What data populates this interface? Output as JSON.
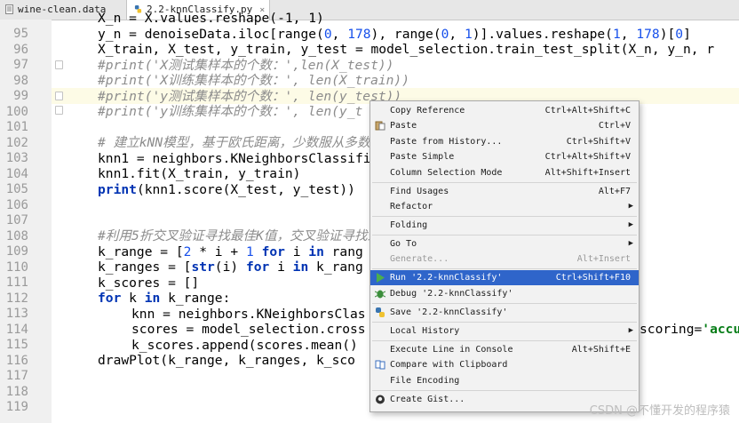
{
  "tabs": [
    {
      "label": "wine-clean.data"
    },
    {
      "label": "2.2-knnClassify.py",
      "close": "×"
    }
  ],
  "line_numbers": [
    "95",
    "96",
    "97",
    "98",
    "99",
    "100",
    "101",
    "102",
    "103",
    "104",
    "105",
    "106",
    "107",
    "108",
    "109",
    "110",
    "111",
    "112",
    "113",
    "114",
    "115",
    "116",
    "117",
    "118",
    "119"
  ],
  "code": {
    "l94": "X_n = X.values.reshape(-1, 1)",
    "l95_a": "y_n = denoiseData.iloc[range(",
    "l95_n1": "0",
    "l95_b": ", ",
    "l95_n2": "178",
    "l95_c": "), range(",
    "l95_n3": "0",
    "l95_d": ", ",
    "l95_n4": "1",
    "l95_e": ")].values.reshape(",
    "l95_n5": "1",
    "l95_f": ", ",
    "l95_n6": "178",
    "l95_g": ")[",
    "l95_n7": "0",
    "l95_h": "]",
    "l96": "X_train, X_test, y_train, y_test = model_selection.train_test_split(X_n, y_n, r",
    "l97": "#print('X测试集样本的个数：',len(X_test))",
    "l98": "#print('X训练集样本的个数：', len(X_train))",
    "l99": "#print('y测试集样本的个数：', len(y_test))",
    "l100": "#print('y训练集样本的个数：', len(y_t",
    "l102": "# 建立kNN模型，基于欧氏距离，少数服从多数",
    "l103": "knn1 = neighbors.KNeighborsClassifi",
    "l104": "knn1.fit(X_train, y_train)",
    "l105_fn": "print",
    "l105_rest": "(knn1.score(X_test, y_test))",
    "l108": "#利用5折交叉验证寻找最佳K值，交叉验证寻找最",
    "l109_a": "k_range = [",
    "l109_n1": "2",
    "l109_b": " * i + ",
    "l109_n2": "1",
    "l109_sp": " ",
    "l109_kw1": "for",
    "l109_c": " i ",
    "l109_kw2": "in",
    "l109_d": " rang",
    "l110_a": "k_ranges = [",
    "l110_fn": "str",
    "l110_b": "(i) ",
    "l110_kw1": "for",
    "l110_c": " i ",
    "l110_kw2": "in",
    "l110_d": " k_rang",
    "l111": "k_scores = []",
    "l112_kw1": "for",
    "l112_a": " k ",
    "l112_kw2": "in",
    "l112_b": " k_range:",
    "l113": "knn = neighbors.KNeighborsClas",
    "l114_a": "scores = model_selection.cross",
    "l114_tail_a": "scoring=",
    "l114_tail_str": "'accu",
    "l115": "k_scores.append(scores.mean()",
    "l116": "drawPlot(k_range, k_ranges, k_sco"
  },
  "context_menu": {
    "items": [
      {
        "label": "Copy Reference",
        "shortcut": "Ctrl+Alt+Shift+C"
      },
      {
        "label": "Paste",
        "shortcut": "Ctrl+V"
      },
      {
        "label": "Paste from History...",
        "shortcut": "Ctrl+Shift+V"
      },
      {
        "label": "Paste Simple",
        "shortcut": "Ctrl+Alt+Shift+V"
      },
      {
        "label": "Column Selection Mode",
        "shortcut": "Alt+Shift+Insert"
      },
      {
        "label": "Find Usages",
        "shortcut": "Alt+F7"
      },
      {
        "label": "Refactor",
        "arrow": "▶"
      },
      {
        "label": "Folding",
        "arrow": "▶"
      },
      {
        "label": "Go To",
        "arrow": "▶"
      },
      {
        "label": "Generate...",
        "shortcut": "Alt+Insert"
      },
      {
        "label": "Run '2.2-knnClassify'",
        "shortcut": "Ctrl+Shift+F10"
      },
      {
        "label": "Debug '2.2-knnClassify'"
      },
      {
        "label": "Save '2.2-knnClassify'"
      },
      {
        "label": "Local History",
        "arrow": "▶"
      },
      {
        "label": "Execute Line in Console",
        "shortcut": "Alt+Shift+E"
      },
      {
        "label": "Compare with Clipboard"
      },
      {
        "label": "File Encoding"
      },
      {
        "label": "Create Gist..."
      }
    ]
  },
  "watermark": "CSDN @不懂开发的程序猿",
  "colors": {
    "selection": "#2f65ca",
    "keyword": "#0033b3",
    "number": "#1750eb",
    "comment": "#8c8c8c",
    "string": "#067d17"
  }
}
